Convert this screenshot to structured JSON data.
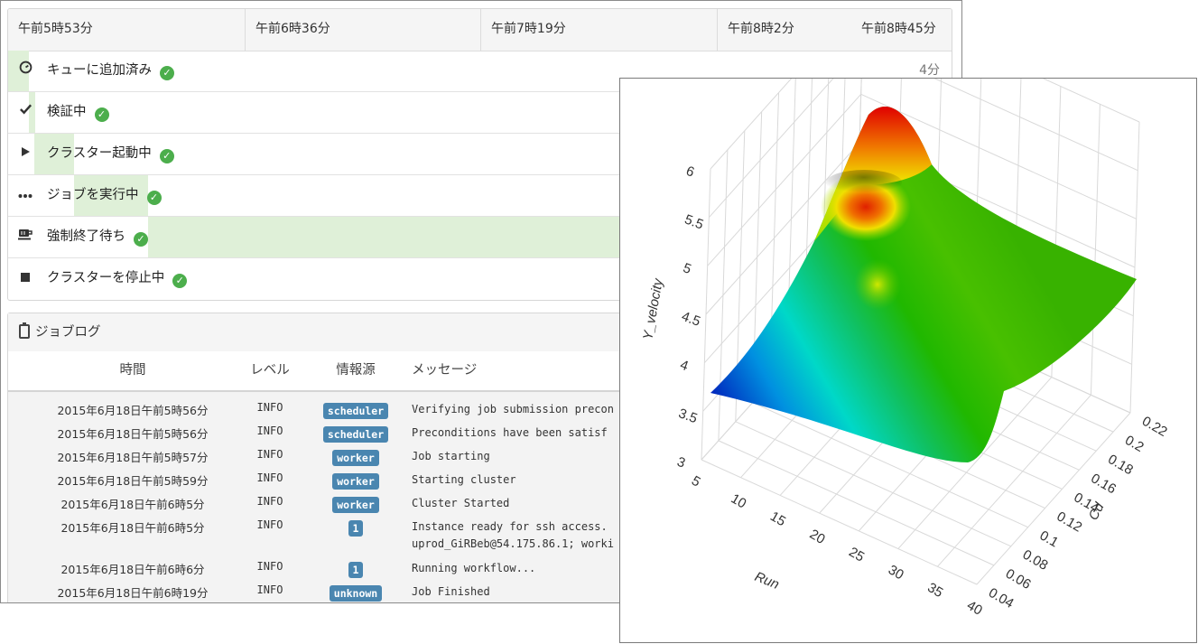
{
  "timeline": {
    "ticks": [
      "午前5時53分",
      "午前6時36分",
      "午前7時19分",
      "午前8時2分",
      "午前8時45分"
    ],
    "stages": [
      {
        "label": "キューに追加済み",
        "icon": "gauge-icon",
        "duration": "4分"
      },
      {
        "label": "検証中",
        "icon": "checkmark-icon"
      },
      {
        "label": "クラスター起動中",
        "icon": "play-icon"
      },
      {
        "label": "ジョブを実行中",
        "icon": "ellipsis-icon"
      },
      {
        "label": "強制終了待ち",
        "icon": "coffee-icon"
      },
      {
        "label": "クラスターを停止中",
        "icon": "stop-icon"
      }
    ]
  },
  "job_log": {
    "title": "ジョブログ",
    "columns": {
      "time": "時間",
      "level": "レベル",
      "source": "情報源",
      "message": "メッセージ"
    },
    "rows": [
      {
        "time": "2015年6月18日午前5時56分",
        "level": "INFO",
        "source": "scheduler",
        "message": "Verifying job submission precon"
      },
      {
        "time": "2015年6月18日午前5時56分",
        "level": "INFO",
        "source": "scheduler",
        "message": "Preconditions have been satisf"
      },
      {
        "time": "2015年6月18日午前5時57分",
        "level": "INFO",
        "source": "worker",
        "message": "Job starting"
      },
      {
        "time": "2015年6月18日午前5時59分",
        "level": "INFO",
        "source": "worker",
        "message": "Starting cluster"
      },
      {
        "time": "2015年6月18日午前6時5分",
        "level": "INFO",
        "source": "worker",
        "message": "Cluster Started"
      },
      {
        "time": "2015年6月18日午前6時5分",
        "level": "INFO",
        "source": "1",
        "message": "Instance ready for ssh access.",
        "message2": "uprod_GiRBeb@54.175.86.1; worki"
      },
      {
        "time": "2015年6月18日午前6時6分",
        "level": "INFO",
        "source": "1",
        "message": "Running workflow..."
      },
      {
        "time": "2015年6月18日午前6時19分",
        "level": "INFO",
        "source": "unknown",
        "message": "Job Finished"
      }
    ]
  },
  "chart_data": {
    "type": "surface",
    "xlabel": "Run",
    "ylabel": "Cd",
    "zlabel": "Y_velocity",
    "x_ticks": [
      5,
      10,
      15,
      20,
      25,
      30,
      35,
      40
    ],
    "y_ticks": [
      0.04,
      0.06,
      0.08,
      0.1,
      0.12,
      0.14,
      0.16,
      0.18,
      0.2,
      0.22
    ],
    "z_ticks": [
      3,
      3.5,
      4,
      4.5,
      5,
      5.5,
      6
    ],
    "xlim": [
      5,
      40
    ],
    "ylim": [
      0.04,
      0.22
    ],
    "zlim": [
      3,
      6
    ],
    "colorscale": "jet",
    "grid": true
  }
}
